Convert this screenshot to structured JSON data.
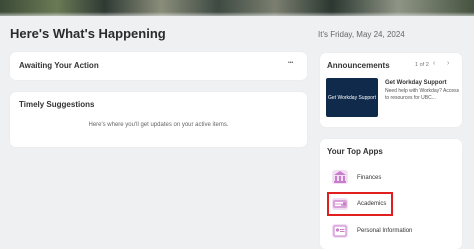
{
  "header": {
    "title": "Here's What's Happening",
    "date": "It's Friday, May 24, 2024"
  },
  "awaiting": {
    "title": "Awaiting Your Action",
    "more_label": "•••"
  },
  "suggestions": {
    "title": "Timely Suggestions",
    "empty_text": "Here's where you'll get updates on your active items."
  },
  "announcements": {
    "title": "Announcements",
    "count": "1 of 2",
    "prev_icon": "chevron-left-icon",
    "next_icon": "chevron-right-icon",
    "thumbnail_text": "Get Workday Support",
    "item_title": "Get Workday Support",
    "item_body": "Need help with Workday? Access to resources for UBC..."
  },
  "top_apps": {
    "title": "Your Top Apps",
    "items": [
      {
        "label": "Finances",
        "icon": "bank-icon"
      },
      {
        "label": "Academics",
        "icon": "academics-icon"
      },
      {
        "label": "Personal Information",
        "icon": "personal-info-icon"
      }
    ]
  },
  "colors": {
    "highlight": "#e0201f",
    "announcement_bg": "#0f2a4a",
    "app_icon_accent": "#c77dcb"
  }
}
